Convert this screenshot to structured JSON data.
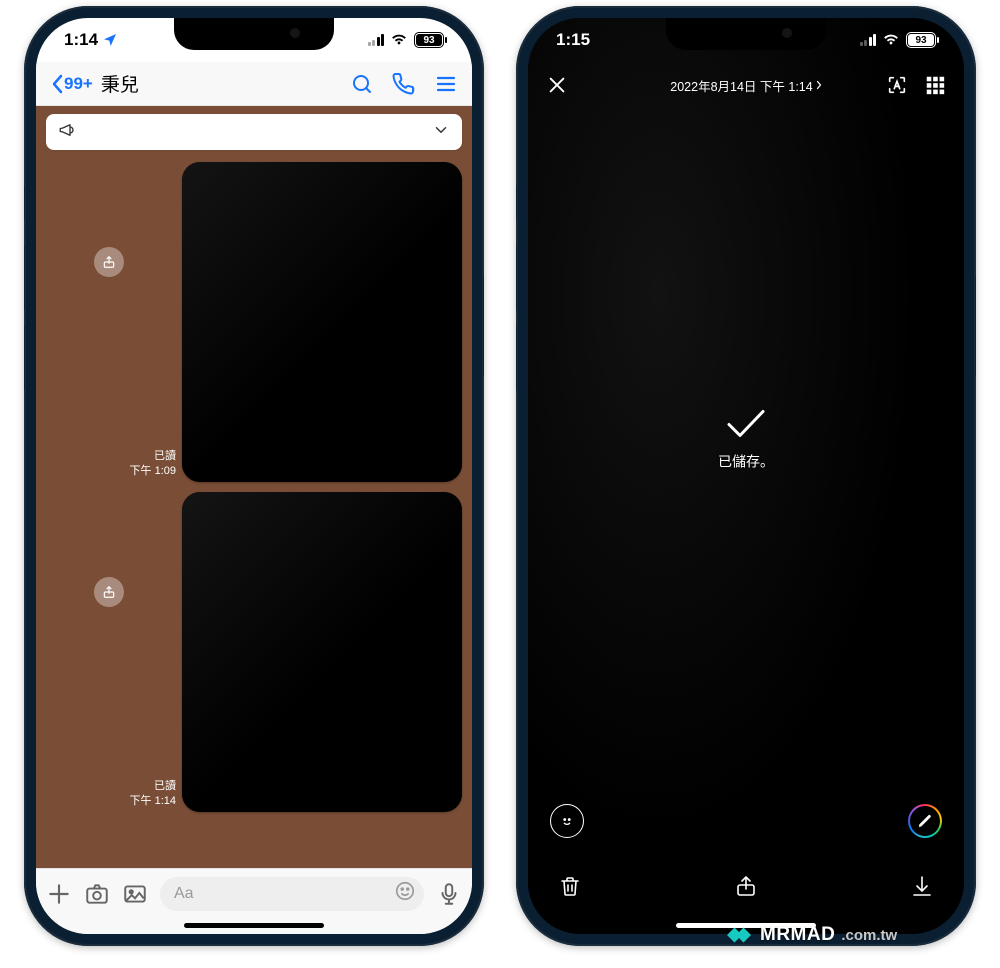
{
  "left": {
    "status": {
      "time": "1:14",
      "battery": "93"
    },
    "header": {
      "back_badge": "99+",
      "title": "秉兒"
    },
    "chat": {
      "placeholder": "Aa",
      "messages": [
        {
          "read": "已讀",
          "time": "下午 1:09"
        },
        {
          "read": "已讀",
          "time": "下午 1:14"
        }
      ]
    }
  },
  "right": {
    "status": {
      "time": "1:15",
      "battery": "93"
    },
    "header": {
      "timestamp": "2022年8月14日 下午 1:14"
    },
    "toast": "已儲存。"
  },
  "watermark": {
    "brand": "MRMAD",
    "domain": ".com.tw"
  }
}
